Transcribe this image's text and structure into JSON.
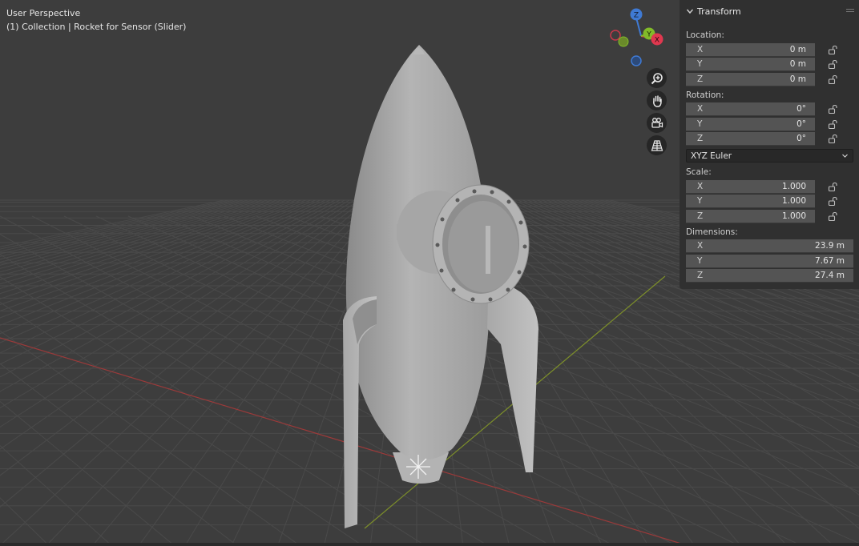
{
  "viewport": {
    "title": "User Perspective",
    "collection": "(1) Collection | Rocket for Sensor (Slider)"
  },
  "gizmo": {
    "z_label": "Z",
    "y_label": "Y",
    "x_label": "X",
    "colors": {
      "x": "#e0384f",
      "y": "#82bb29",
      "z": "#3f7ad4"
    }
  },
  "nav": {
    "icons": [
      "zoom-icon",
      "hand-pan-icon",
      "camera-icon",
      "grid-icon"
    ]
  },
  "panel": {
    "title": "Transform",
    "location": {
      "label": "Location:",
      "x": {
        "axis": "X",
        "value": "0 m"
      },
      "y": {
        "axis": "Y",
        "value": "0 m"
      },
      "z": {
        "axis": "Z",
        "value": "0 m"
      }
    },
    "rotation": {
      "label": "Rotation:",
      "x": {
        "axis": "X",
        "value": "0°"
      },
      "y": {
        "axis": "Y",
        "value": "0°"
      },
      "z": {
        "axis": "Z",
        "value": "0°"
      },
      "mode": "XYZ Euler"
    },
    "scale": {
      "label": "Scale:",
      "x": {
        "axis": "X",
        "value": "1.000"
      },
      "y": {
        "axis": "Y",
        "value": "1.000"
      },
      "z": {
        "axis": "Z",
        "value": "1.000"
      }
    },
    "dimensions": {
      "label": "Dimensions:",
      "x": {
        "axis": "X",
        "value": "23.9 m"
      },
      "y": {
        "axis": "Y",
        "value": "7.67 m"
      },
      "z": {
        "axis": "Z",
        "value": "27.4 m"
      }
    }
  }
}
